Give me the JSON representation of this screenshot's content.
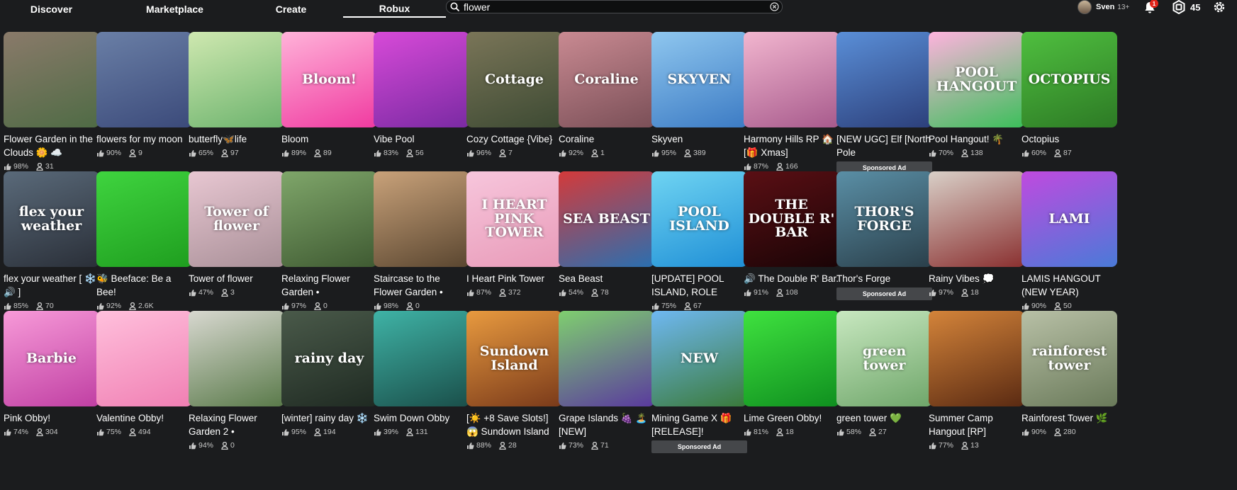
{
  "nav": {
    "tabs": [
      {
        "label": "Discover"
      },
      {
        "label": "Marketplace"
      },
      {
        "label": "Create"
      },
      {
        "label": "Robux"
      }
    ]
  },
  "search": {
    "value": "flower",
    "placeholder": "Search"
  },
  "user": {
    "name": "Sven",
    "age_badge": "13+"
  },
  "notifications": {
    "count": "1"
  },
  "robux": {
    "balance": "45"
  },
  "colors": {
    "background": "#1b1c1e",
    "ad_badge": "#45474a",
    "stat_text": "#c8c8c8"
  },
  "sponsored_label": "Sponsored Ad",
  "games": [
    {
      "title": "Flower Garden in the Clouds 🌼 ☁️",
      "rating": "98%",
      "players": "31",
      "thumb_text": "",
      "c1": "#8a7a6a",
      "c2": "#4f6b45"
    },
    {
      "title": "flowers for my moon",
      "rating": "90%",
      "players": "9",
      "thumb_text": "",
      "c1": "#6a7fa6",
      "c2": "#3b4a7a"
    },
    {
      "title": "butterfly🦋life",
      "rating": "65%",
      "players": "97",
      "thumb_text": "",
      "c1": "#cfe8b0",
      "c2": "#6cb36d"
    },
    {
      "title": "Bloom",
      "rating": "89%",
      "players": "89",
      "thumb_text": "Bloom!",
      "c1": "#ffb3d9",
      "c2": "#f03aa0"
    },
    {
      "title": "Vibe Pool",
      "rating": "83%",
      "players": "56",
      "thumb_text": "",
      "c1": "#d84ad8",
      "c2": "#7a2aa3"
    },
    {
      "title": "Cozy Cottage {Vibe}",
      "rating": "96%",
      "players": "7",
      "thumb_text": "Cottage",
      "c1": "#7a7558",
      "c2": "#3d4a33"
    },
    {
      "title": "Coraline",
      "rating": "92%",
      "players": "1",
      "thumb_text": "Coraline",
      "c1": "#c98a92",
      "c2": "#7a4f57"
    },
    {
      "title": "Skyven",
      "rating": "95%",
      "players": "389",
      "thumb_text": "SKYVEN",
      "c1": "#8fc7ef",
      "c2": "#3c7bc4"
    },
    {
      "title": "Harmony Hills RP 🏠 [🎁 Xmas]",
      "rating": "87%",
      "players": "166",
      "thumb_text": "",
      "c1": "#f2b6cf",
      "c2": "#a75a8c"
    },
    {
      "title": "[NEW UGC] Elf [North Pole",
      "rating": "",
      "players": "",
      "thumb_text": "",
      "c1": "#5a8fd8",
      "c2": "#2c3f7a",
      "sponsored": true
    },
    {
      "title": "Pool Hangout! 🌴",
      "rating": "70%",
      "players": "138",
      "thumb_text": "POOL HANGOUT",
      "c1": "#ffb3de",
      "c2": "#3bbf5a"
    },
    {
      "title": "Octopius",
      "rating": "60%",
      "players": "87",
      "thumb_text": "OCTOPIUS",
      "c1": "#4fbf3f",
      "c2": "#2d7a25"
    },
    {
      "title": "flex your weather [ ❄️ 🔊 ]",
      "rating": "85%",
      "players": "70",
      "thumb_text": "flex your weather",
      "c1": "#5a6a7a",
      "c2": "#2a2f38"
    },
    {
      "title": "🐝 Beeface: Be a Bee!",
      "rating": "92%",
      "players": "2.6K",
      "thumb_text": "",
      "c1": "#3fd43f",
      "c2": "#1f9e1f"
    },
    {
      "title": "Tower of flower",
      "rating": "47%",
      "players": "3",
      "thumb_text": "Tower of flower",
      "c1": "#e8c7d2",
      "c2": "#a88f97"
    },
    {
      "title": "Relaxing Flower Garden •",
      "rating": "97%",
      "players": "0",
      "thumb_text": "",
      "c1": "#7fa66a",
      "c2": "#3f5a32"
    },
    {
      "title": "Staircase to the Flower Garden •",
      "rating": "98%",
      "players": "0",
      "thumb_text": "",
      "c1": "#c9a27a",
      "c2": "#5a4630"
    },
    {
      "title": "I Heart Pink Tower",
      "rating": "87%",
      "players": "372",
      "thumb_text": "I HEART PINK TOWER",
      "c1": "#f7c6dc",
      "c2": "#e89ab8"
    },
    {
      "title": "Sea Beast",
      "rating": "54%",
      "players": "78",
      "thumb_text": "SEA BEAST",
      "c1": "#d43a3a",
      "c2": "#2a6fb0"
    },
    {
      "title": "[UPDATE] POOL ISLAND, ROLE",
      "rating": "75%",
      "players": "67",
      "thumb_text": "POOL ISLAND",
      "c1": "#6fd4f2",
      "c2": "#1f8fd6"
    },
    {
      "title": "🔊 The Double R' Bar.",
      "rating": "91%",
      "players": "108",
      "thumb_text": "THE DOUBLE R' BAR",
      "c1": "#5a0f14",
      "c2": "#1a0406"
    },
    {
      "title": "Thor's Forge",
      "rating": "",
      "players": "",
      "thumb_text": "THOR'S FORGE",
      "c1": "#5a8fa6",
      "c2": "#2a3f4a",
      "sponsored": true
    },
    {
      "title": "Rainy Vibes 💭",
      "rating": "97%",
      "players": "18",
      "thumb_text": "",
      "c1": "#d9d0c8",
      "c2": "#8a3030"
    },
    {
      "title": "LAMIS HANGOUT (NEW YEAR)",
      "rating": "90%",
      "players": "50",
      "thumb_text": "LAMI",
      "c1": "#c04adf",
      "c2": "#4a7ad8"
    },
    {
      "title": "Pink Obby!",
      "rating": "74%",
      "players": "304",
      "thumb_text": "Barbie",
      "c1": "#f79ad8",
      "c2": "#c03fa3"
    },
    {
      "title": "Valentine Obby!",
      "rating": "75%",
      "players": "494",
      "thumb_text": "",
      "c1": "#ffc0dc",
      "c2": "#f07fb3"
    },
    {
      "title": "Relaxing Flower Garden 2 •",
      "rating": "94%",
      "players": "0",
      "thumb_text": "",
      "c1": "#d8d8d0",
      "c2": "#5a7a4a"
    },
    {
      "title": "[winter] rainy day ❄️",
      "rating": "95%",
      "players": "194",
      "thumb_text": "rainy day",
      "c1": "#4a5a4a",
      "c2": "#1f2a22"
    },
    {
      "title": "Swim Down Obby",
      "rating": "39%",
      "players": "131",
      "thumb_text": "",
      "c1": "#3fb3a6",
      "c2": "#1a4f4a"
    },
    {
      "title": "[☀️ +8 Save Slots!] 😱 Sundown Island",
      "rating": "88%",
      "players": "28",
      "thumb_text": "Sundown Island",
      "c1": "#e89a3f",
      "c2": "#7a3a1a"
    },
    {
      "title": "Grape Islands 🍇 🏝️ [NEW]",
      "rating": "73%",
      "players": "71",
      "thumb_text": "",
      "c1": "#7fcf6f",
      "c2": "#5a3a9e"
    },
    {
      "title": "Mining Game X 🎁 [RELEASE]!",
      "rating": "",
      "players": "",
      "thumb_text": "NEW",
      "c1": "#6fb8f2",
      "c2": "#3a7a3a",
      "sponsored": true
    },
    {
      "title": "Lime Green Obby!",
      "rating": "81%",
      "players": "18",
      "thumb_text": "",
      "c1": "#3fe23f",
      "c2": "#0f8f1f"
    },
    {
      "title": "green tower 💚",
      "rating": "58%",
      "players": "27",
      "thumb_text": "green tower",
      "c1": "#c8e8c0",
      "c2": "#6fa66a"
    },
    {
      "title": "Summer Camp Hangout [RP]",
      "rating": "77%",
      "players": "13",
      "thumb_text": "",
      "c1": "#d4843a",
      "c2": "#5a2a12"
    },
    {
      "title": "Rainforest Tower 🌿",
      "rating": "90%",
      "players": "280",
      "thumb_text": "rainforest tower",
      "c1": "#b8c0a6",
      "c2": "#6a7a5a"
    }
  ]
}
